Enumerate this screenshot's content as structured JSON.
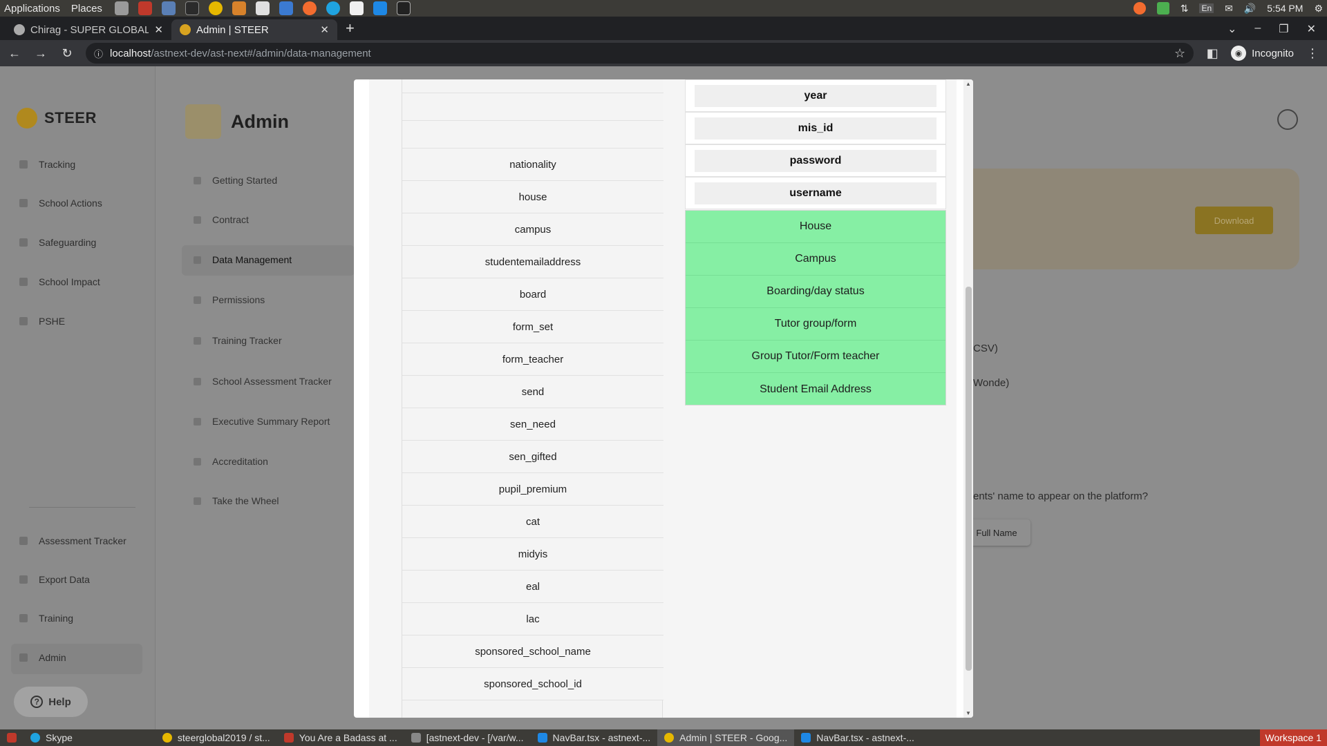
{
  "os_top": {
    "applications": "Applications",
    "places": "Places",
    "time": "5:54 PM",
    "keyboard": "En"
  },
  "browser": {
    "tabs": [
      {
        "label": "Chirag - SUPER GLOBAL A",
        "active": false
      },
      {
        "label": "Admin | STEER",
        "active": true
      }
    ],
    "url_host": "localhost",
    "url_path": "/astnext-dev/ast-next#/admin/data-management",
    "incognito_label": "Incognito"
  },
  "sidebar": {
    "brand": "STEER",
    "items": [
      "Tracking",
      "School Actions",
      "Safeguarding",
      "School Impact",
      "PSHE"
    ],
    "bottom_items": [
      "Assessment Tracker",
      "Export Data",
      "Training",
      "Admin"
    ],
    "help": "Help"
  },
  "admin": {
    "title": "Admin",
    "submenu": [
      "Getting Started",
      "Contract",
      "Data Management",
      "Permissions",
      "Training Tracker",
      "School Assessment Tracker",
      "Executive Summary Report",
      "Accreditation",
      "Take the Wheel"
    ],
    "active": "Data Management"
  },
  "background": {
    "download": "Download",
    "csv_fragment": "CSV)",
    "wonde_fragment": "Wonde)",
    "question_fragment": "ents' name to appear on the platform?",
    "fullname_button": "Full Name"
  },
  "modal": {
    "source_fields": [
      "",
      "",
      "",
      "nationality",
      "house",
      "campus",
      "studentemailaddress",
      "board",
      "form_set",
      "form_teacher",
      "send",
      "sen_need",
      "sen_gifted",
      "pupil_premium",
      "cat",
      "midyis",
      "eal",
      "lac",
      "sponsored_school_name",
      "sponsored_school_id"
    ],
    "required_keys": [
      "year",
      "mis_id",
      "password",
      "username"
    ],
    "mapped_fields": [
      "House",
      "Campus",
      "Boarding/day status",
      "Tutor group/form",
      "Group Tutor/Form teacher",
      "Student Email Address"
    ],
    "mapped_color": "#86efa4"
  },
  "os_bottom": {
    "tasks": [
      "Skype",
      "steerglobal2019 / st...",
      "You Are a Badass at ...",
      "[astnext-dev - [/var/w...",
      "NavBar.tsx - astnext-...",
      "Admin | STEER - Goog...",
      "NavBar.tsx - astnext-..."
    ],
    "workspace": "Workspace 1"
  }
}
